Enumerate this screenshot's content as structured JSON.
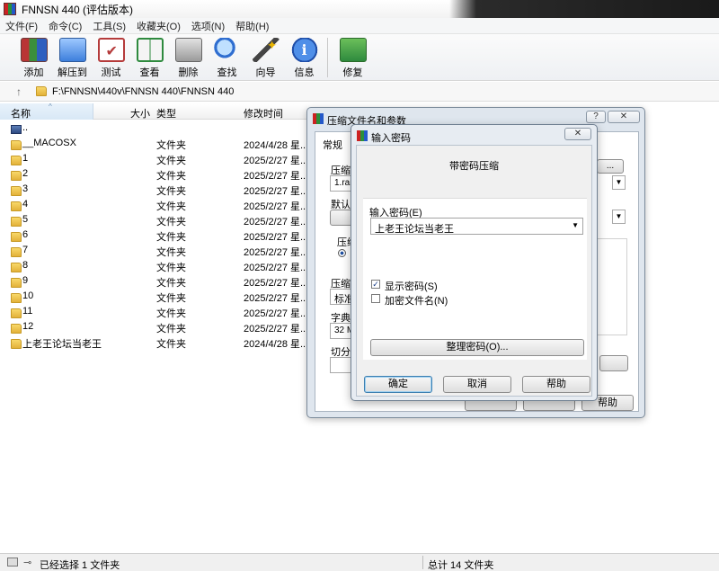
{
  "window": {
    "title": "FNNSN 440 (评估版本)"
  },
  "menu": [
    "文件(F)",
    "命令(C)",
    "工具(S)",
    "收藏夹(O)",
    "选项(N)",
    "帮助(H)"
  ],
  "toolbar": {
    "add": "添加",
    "extract": "解压到",
    "test": "测试",
    "view": "查看",
    "delete": "删除",
    "find": "查找",
    "wizard": "向导",
    "info": "信息",
    "repair": "修复"
  },
  "address": {
    "path": "F:\\FNNSN\\440v\\FNNSN 440\\FNNSN 440"
  },
  "columns": {
    "name": "名称",
    "size": "大小",
    "type": "类型",
    "modified": "修改时间"
  },
  "files": [
    {
      "name": "..",
      "type": "",
      "date": ""
    },
    {
      "name": "__MACOSX",
      "type": "文件夹",
      "date": "2024/4/28 星..."
    },
    {
      "name": "1",
      "type": "文件夹",
      "date": "2025/2/27 星..."
    },
    {
      "name": "2",
      "type": "文件夹",
      "date": "2025/2/27 星..."
    },
    {
      "name": "3",
      "type": "文件夹",
      "date": "2025/2/27 星..."
    },
    {
      "name": "4",
      "type": "文件夹",
      "date": "2025/2/27 星..."
    },
    {
      "name": "5",
      "type": "文件夹",
      "date": "2025/2/27 星..."
    },
    {
      "name": "6",
      "type": "文件夹",
      "date": "2025/2/27 星..."
    },
    {
      "name": "7",
      "type": "文件夹",
      "date": "2025/2/27 星..."
    },
    {
      "name": "8",
      "type": "文件夹",
      "date": "2025/2/27 星..."
    },
    {
      "name": "9",
      "type": "文件夹",
      "date": "2025/2/27 星..."
    },
    {
      "name": "10",
      "type": "文件夹",
      "date": "2025/2/27 星..."
    },
    {
      "name": "11",
      "type": "文件夹",
      "date": "2025/2/27 星..."
    },
    {
      "name": "12",
      "type": "文件夹",
      "date": "2025/2/27 星..."
    },
    {
      "name": "上老王论坛当老王",
      "type": "文件夹",
      "date": "2024/4/28 星..."
    }
  ],
  "status": {
    "selected": "已经选择 1 文件夹",
    "total": "总计 14 文件夹"
  },
  "params_dialog": {
    "title": "压缩文件名和参数",
    "help_glyph": "?",
    "close_glyph": "✕",
    "tab_general": "常规",
    "lbl_archive": "压缩文",
    "archive_value": "1.rar",
    "lbl_default": "默认配",
    "lbl_format": "压缩",
    "lbl_method": "压缩方",
    "method_value": "标准",
    "lbl_dict": "字典大",
    "dict_value": "32 MB",
    "lbl_split": "切分为",
    "browse_frag": "...",
    "help_button": "帮助"
  },
  "password_dialog": {
    "title": "输入密码",
    "close_glyph": "✕",
    "heading": "带密码压缩",
    "field_label": "输入密码(E)",
    "password_value": "上老王论坛当老王",
    "show_password": "显示密码(S)",
    "show_password_checked": true,
    "encrypt_names": "加密文件名(N)",
    "encrypt_names_checked": false,
    "organize_button": "整理密码(O)...",
    "ok": "确定",
    "cancel": "取消",
    "help": "帮助"
  }
}
